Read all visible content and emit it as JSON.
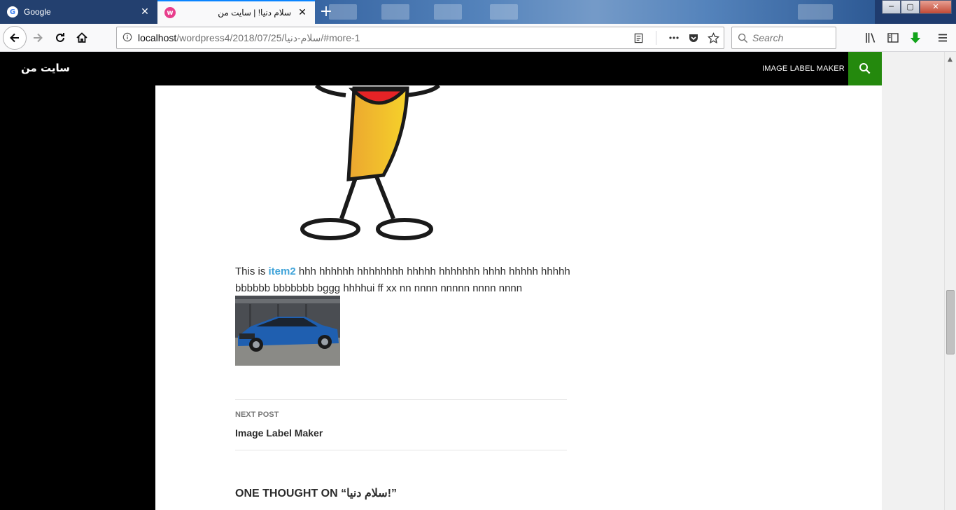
{
  "browser": {
    "tabs": [
      {
        "title": "Google",
        "favicon": "google-icon"
      },
      {
        "title": "سلام دنیا! | سایت من",
        "favicon": "wordpress-local-icon"
      }
    ],
    "url": {
      "host": "localhost",
      "path": "/wordpress4/2018/07/25/سلام-دنیا/#more-1"
    },
    "search_placeholder": "Search",
    "window_controls": {
      "minimize": "─",
      "maximize": "▢",
      "close": "✕"
    }
  },
  "site": {
    "title": "سایت من",
    "menu_item": "IMAGE LABEL MAKER",
    "accent_color": "#24890d",
    "link_color": "#41a4d9"
  },
  "post": {
    "text_before": "This is ",
    "link_text": "item2",
    "text_after": " hhh hhhhhh hhhhhhhh hhhhh hhhhhhh hhhh hhhhh hhhhh bbbbbb bbbbbbb bggg hhhhui ff xx nn nnnn nnnnn nnnn nnnn"
  },
  "post_nav": {
    "label": "NEXT POST",
    "title": "Image Label Maker"
  },
  "comments": {
    "heading": "ONE THOUGHT ON “سلام دنیا!”"
  }
}
